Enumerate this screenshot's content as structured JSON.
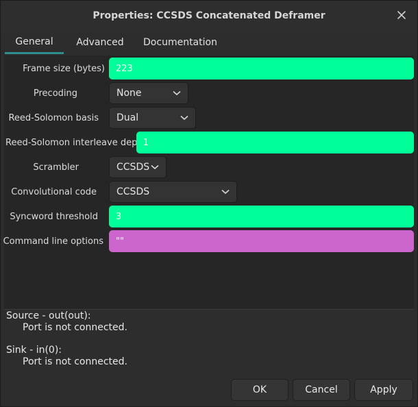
{
  "window": {
    "title": "Properties: CCSDS Concatenated Deframer"
  },
  "tabs": [
    {
      "label": "General",
      "active": true
    },
    {
      "label": "Advanced",
      "active": false
    },
    {
      "label": "Documentation",
      "active": false
    }
  ],
  "fields": {
    "frame_size": {
      "label": "Frame size (bytes)",
      "value": "223"
    },
    "precoding": {
      "label": "Precoding",
      "value": "None"
    },
    "rs_basis": {
      "label": "Reed-Solomon basis",
      "value": "Dual"
    },
    "rs_interleave": {
      "label": "Reed-Solomon interleave depth",
      "value": "1"
    },
    "scrambler": {
      "label": "Scrambler",
      "value": "CCSDS"
    },
    "conv_code": {
      "label": "Convolutional code",
      "value": "CCSDS"
    },
    "sync_threshold": {
      "label": "Syncword threshold",
      "value": "3"
    },
    "cmd_options": {
      "label": "Command line options",
      "value": "\"\""
    }
  },
  "ports": {
    "source_title": "Source - out(out):",
    "source_status": "Port is not connected.",
    "sink_title": "Sink - in(0):",
    "sink_status": "Port is not connected."
  },
  "buttons": {
    "ok": "OK",
    "cancel": "Cancel",
    "apply": "Apply"
  },
  "icons": {
    "close": "close-icon",
    "dropdown": "chevron-down-icon"
  },
  "colors": {
    "int_field": "#00ff99",
    "string_field": "#cc66cc",
    "active_tab_underline": "#2f8f8f"
  }
}
